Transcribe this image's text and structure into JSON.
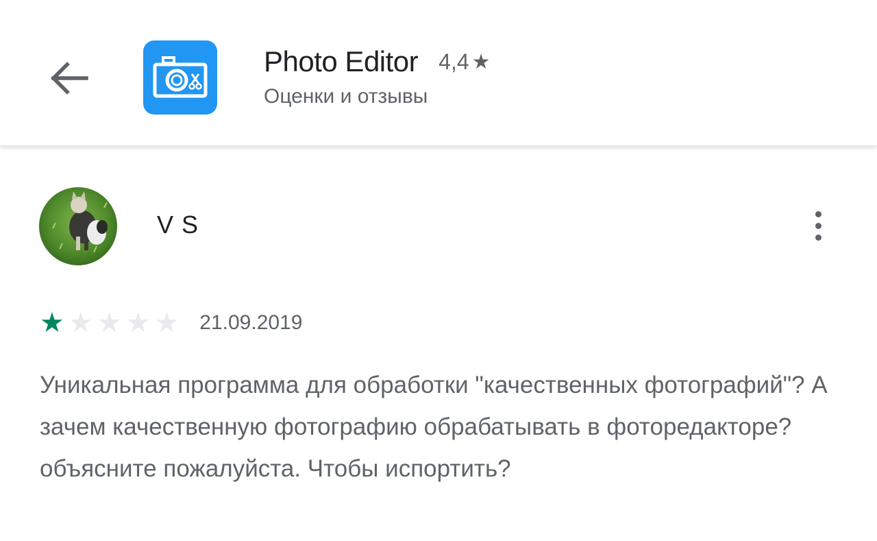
{
  "header": {
    "app_title": "Photo Editor",
    "app_rating": "4,4",
    "rating_star": "★",
    "subtitle": "Оценки и отзывы",
    "icons": {
      "back": "arrow-back-icon",
      "app": "camera-app-icon"
    },
    "colors": {
      "app_icon_bg": "#2196f3",
      "text_primary": "#202124",
      "text_secondary": "#5f6368"
    }
  },
  "review": {
    "reviewer_name": "V S",
    "avatar": "avatar-photo-dog-on-grass",
    "more_icon": "more-vert-icon",
    "stars": {
      "filled": 1,
      "total": 5
    },
    "star_glyph": "★",
    "date": "21.09.2019",
    "text": "Уникальная программа для обработки \"качественных фотографий\"? А зачем качественную фотографию обрабатывать в фоторедакторе? объясните пожалуйста. Чтобы испортить?",
    "colors": {
      "star_filled": "#01875f",
      "star_empty": "#e8eaed"
    }
  }
}
